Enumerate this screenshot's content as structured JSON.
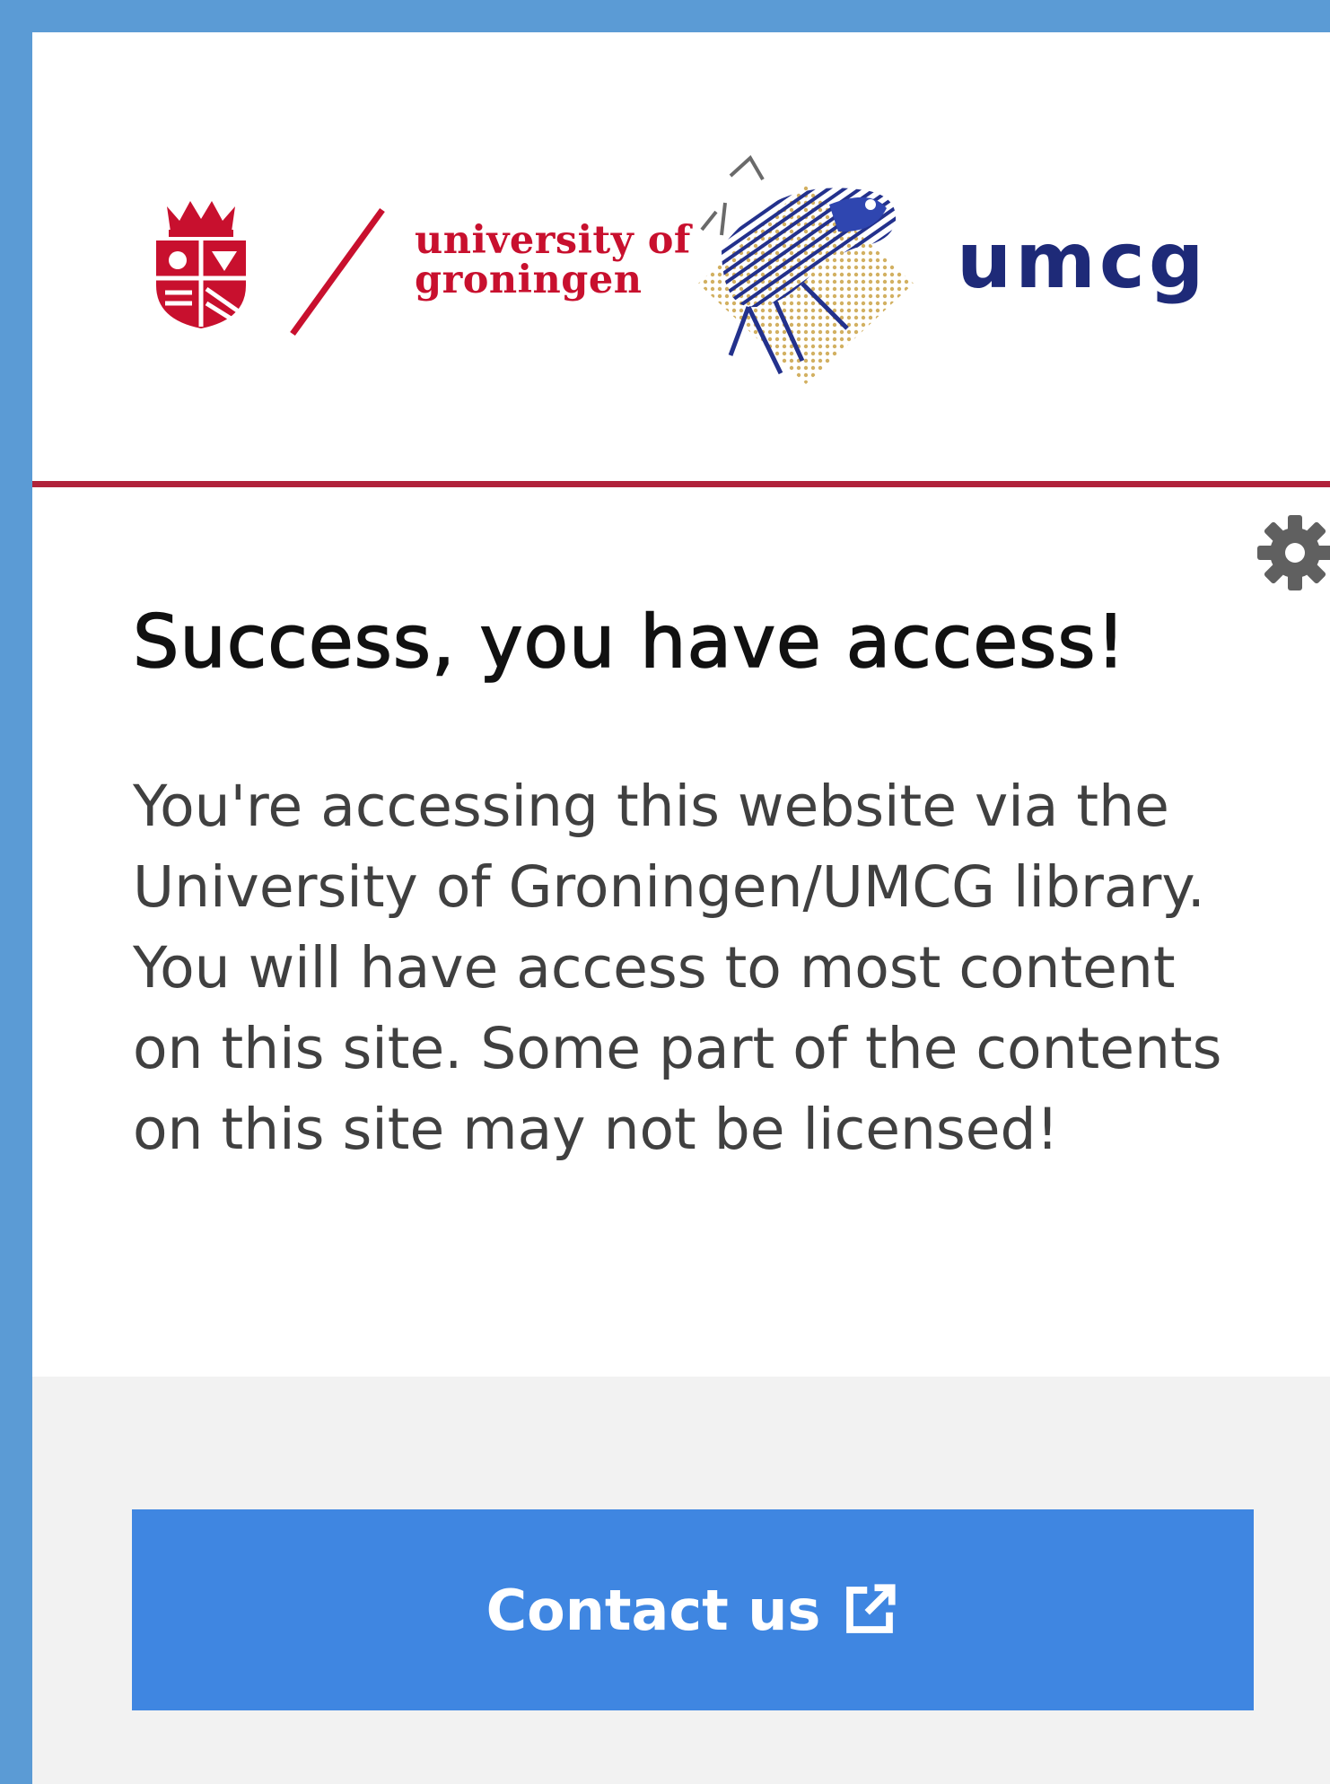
{
  "header": {
    "university_line1": "university of",
    "university_line2": "groningen",
    "umcg_logo_text": "umcg"
  },
  "colors": {
    "page_background": "#5b9bd5",
    "university_red": "#c8102e",
    "divider_red": "#b0223a",
    "umcg_navy": "#1e2a78",
    "button_blue": "#3f86e1",
    "footer_gray": "#f2f2f2"
  },
  "icons": {
    "settings": "gear-icon",
    "external_link": "external-link-icon",
    "crest": "university-crest-icon",
    "frog": "umcg-frog-logo"
  },
  "content": {
    "title": "Success, you have access!",
    "message": "You're accessing this website via the University of Groningen/UMCG library. You will have access to most content on this site. Some part of the contents on this site may not be licensed!"
  },
  "footer": {
    "contact_label": "Contact us"
  }
}
